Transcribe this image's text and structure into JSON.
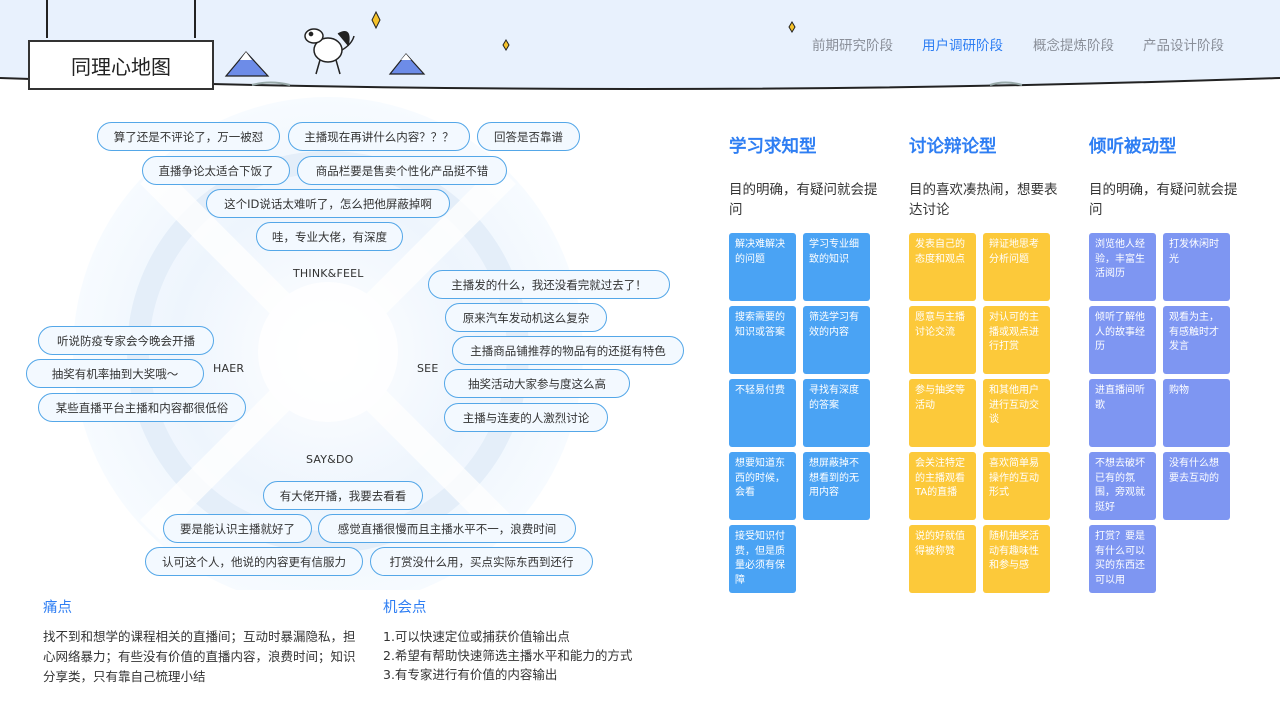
{
  "header": {
    "title": "同理心地图",
    "nav": [
      "前期研究阶段",
      "用户调研阶段",
      "概念提炼阶段",
      "产品设计阶段"
    ],
    "active_nav_index": 1
  },
  "map": {
    "labels": {
      "think": "THINK&FEEL",
      "hear": "HAER",
      "see": "SEE",
      "say": "SAY&DO"
    },
    "think": [
      "算了还是不评论了，万一被怼",
      "主播现在再讲什么内容？？？",
      "回答是否靠谱",
      "直播争论太适合下饭了",
      "商品栏要是售卖个性化产品挺不错",
      "这个ID说话太难听了，怎么把他屏蔽掉啊",
      "哇，专业大佬，有深度"
    ],
    "hear": [
      "听说防疫专家会今晚会开播",
      "抽奖有机率抽到大奖哦～",
      "某些直播平台主播和内容都很低俗"
    ],
    "see": [
      "主播发的什么，我还没看完就过去了！",
      "原来汽车发动机这么复杂",
      "主播商品铺推荐的物品有的还挺有特色",
      "抽奖活动大家参与度这么高",
      "主播与连麦的人激烈讨论"
    ],
    "say": [
      "有大佬开播，我要去看看",
      "要是能认识主播就好了",
      "感觉直播很慢而且主播水平不一，浪费时间",
      "认可这个人，他说的内容更有信服力",
      "打赏没什么用，买点实际东西到还行"
    ]
  },
  "pain": {
    "title": "痛点",
    "text": "找不到和想学的课程相关的直播间；互动时暴漏隐私，担心网络暴力；有些没有价值的直播内容，浪费时间；知识分享类，只有靠自己梳理小结"
  },
  "opportunity": {
    "title": "机会点",
    "items": [
      "1.可以快速定位或捕获价值输出点",
      "2.希望有帮助快速筛选主播水平和能力的方式",
      "3.有专家进行有价值的内容输出"
    ]
  },
  "user_types": [
    {
      "title": "学习求知型",
      "desc": "目的明确，有疑问就会提问",
      "color": "#4aa3f4",
      "cards": [
        "解决难解决的问题",
        "学习专业细致的知识",
        "搜索需要的知识或答案",
        "筛选学习有效的内容",
        "不轻易付费",
        "寻找有深度的答案",
        "想要知道东西的时候，会看",
        "想屏蔽掉不想看到的无用内容",
        "接受知识付费，但是质量必须有保障"
      ]
    },
    {
      "title": "讨论辩论型",
      "desc": "目的喜欢凑热闹，想要表达讨论",
      "color": "#fcc93a",
      "cards": [
        "发表自己的态度和观点",
        "辩证地思考分析问题",
        "愿意与主播讨论交流",
        "对认可的主播或观点进行打赏",
        "参与抽奖等活动",
        "和其他用户进行互动交谈",
        "会关注特定的主播观看TA的直播",
        "喜欢简单易操作的互动形式",
        "说的好就值得被称赞",
        "随机抽奖活动有趣味性和参与感"
      ]
    },
    {
      "title": "倾听被动型",
      "desc": "目的明确，有疑问就会提问",
      "color": "#7e96f2",
      "cards": [
        "浏览他人经验，丰富生活阅历",
        "打发休闲时光",
        "倾听了解他人的故事经历",
        "观看为主，有感触时才发言",
        "进直播间听歌",
        "购物",
        "不想去破坏已有的氛围，旁观就挺好",
        "没有什么想要去互动的",
        "打赏？要是有什么可以买的东西还可以用"
      ]
    }
  ]
}
